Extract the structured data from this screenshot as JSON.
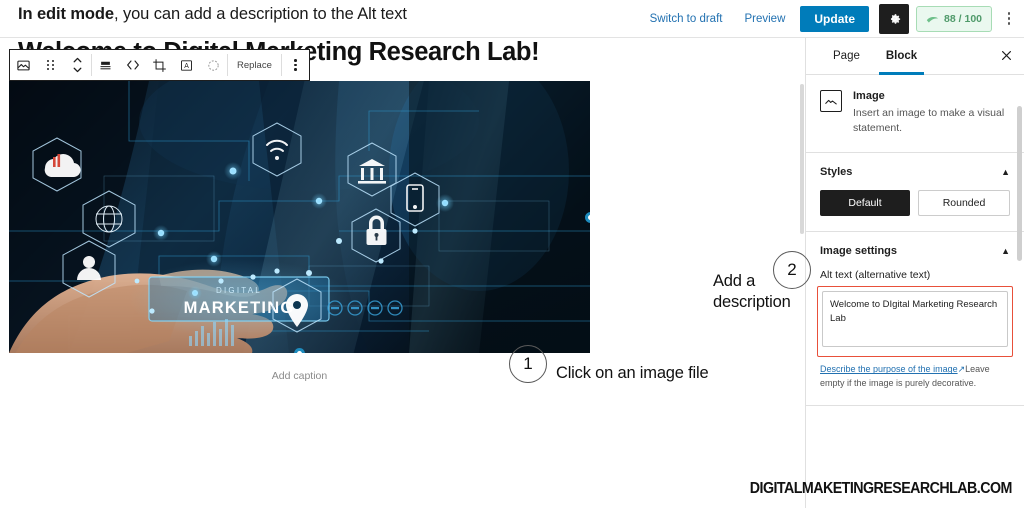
{
  "instruction": {
    "bold": "In edit mode",
    "rest": ", you can add a description to the Alt text"
  },
  "adminbar": {
    "switch_to_draft": "Switch to draft",
    "preview": "Preview",
    "update": "Update",
    "settings_icon": "gear-icon",
    "seo_score": "88 / 100",
    "options_icon": "kebab-vertical-icon"
  },
  "editor": {
    "post_title": "Welcome to Digital Marketing Research Lab!",
    "caption_placeholder": "Add caption",
    "toolbar": {
      "block_type_icon": "image-block-icon",
      "drag_icon": "drag-handle-icon",
      "move_icon": "move-up-down-icon",
      "align_icon": "align-icon",
      "link_icon": "link-icon",
      "crop_icon": "crop-icon",
      "text_overlay_icon": "add-text-over-image-icon",
      "filter_icon": "duotone-filter-icon",
      "replace_label": "Replace",
      "more_icon": "kebab-vertical-icon"
    },
    "image": {
      "alt_described": "Digital marketing concept: hand touching a glowing blue interface with hexagon icons",
      "overlay_small_text": "DIGITAL",
      "overlay_big_text": "MARKETING",
      "hex_icons": [
        "cloud-upload-download-icon",
        "globe-icon",
        "user-icon",
        "wifi-icon",
        "bank-icon",
        "mobile-phone-icon",
        "lock-icon",
        "map-pin-icon"
      ]
    }
  },
  "annotations": [
    {
      "number": "1",
      "label": "Click on an image file"
    },
    {
      "number": "2",
      "label": "Add a description"
    }
  ],
  "sidebar": {
    "tabs": [
      {
        "label": "Page",
        "active": false
      },
      {
        "label": "Block",
        "active": true
      }
    ],
    "close_icon": "close-icon",
    "block_card": {
      "icon": "image-block-icon",
      "title": "Image",
      "description": "Insert an image to make a visual statement."
    },
    "styles": {
      "heading": "Styles",
      "collapse_icon": "chevron-up-icon",
      "options": [
        {
          "label": "Default",
          "selected": true
        },
        {
          "label": "Rounded",
          "selected": false
        }
      ]
    },
    "image_settings": {
      "heading": "Image settings",
      "collapse_icon": "chevron-up-icon",
      "alt_label": "Alt text (alternative text)",
      "alt_value": "Welcome to DIgital Marketing Research Lab",
      "help_link": "Describe the purpose of the image",
      "help_link_icon": "external-link-icon",
      "help_rest": "Leave empty if the image is purely decorative."
    }
  },
  "watermark": "DIGITALMAKETINGRESEARCHLAB.COM",
  "colors": {
    "accent_blue": "#007cba",
    "link_blue": "#2271b1",
    "dark": "#1e1e1e",
    "highlight_red": "#e8503a",
    "score_green": "#4f9a6a"
  }
}
